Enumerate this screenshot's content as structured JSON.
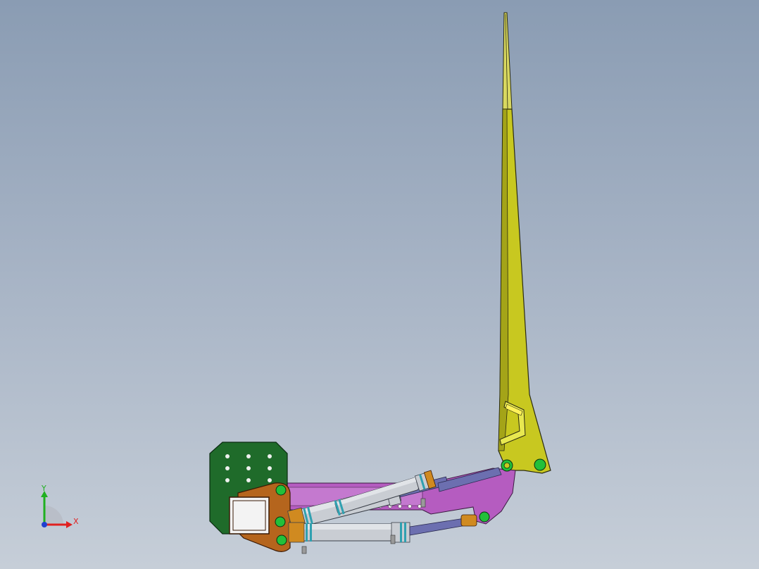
{
  "viewport": {
    "background_top": "#8a9cb3",
    "background_bottom": "#c6ced8"
  },
  "model": {
    "parts": [
      {
        "name": "mounting-plate",
        "color": "#1f6b2a"
      },
      {
        "name": "base-bracket",
        "color": "#b5651d"
      },
      {
        "name": "link-arm",
        "color": "#b55cc0"
      },
      {
        "name": "hydraulic-cylinder",
        "color": "#c9cdd3"
      },
      {
        "name": "piston-rod",
        "color": "#6c6fb0"
      },
      {
        "name": "boom-arm",
        "color": "#c2c21f"
      },
      {
        "name": "pivot-pin",
        "color": "#22c03a"
      }
    ]
  },
  "triad": {
    "x_label": "X",
    "y_label": "Y",
    "x_color": "#e02020",
    "y_color": "#20b020",
    "z_color": "#2040d0"
  }
}
